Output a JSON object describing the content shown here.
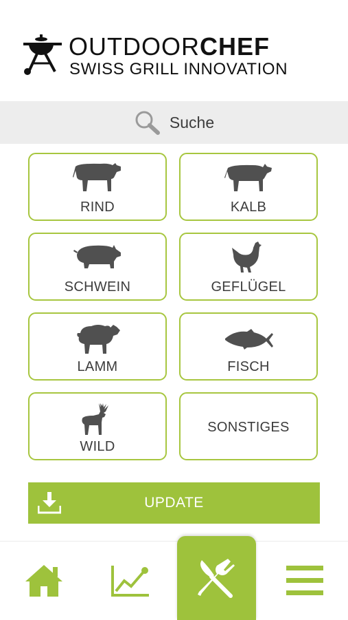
{
  "header": {
    "brand_light": "OUTDOOR",
    "brand_bold": "CHEF",
    "tagline": "SWISS GRILL INNOVATION",
    "logo_icon": "grill-icon"
  },
  "search": {
    "label": "Suche",
    "icon": "search-icon"
  },
  "categories": [
    {
      "label": "RIND",
      "icon": "cow-icon"
    },
    {
      "label": "KALB",
      "icon": "calf-icon"
    },
    {
      "label": "SCHWEIN",
      "icon": "pig-icon"
    },
    {
      "label": "GEFLÜGEL",
      "icon": "chicken-icon"
    },
    {
      "label": "LAMM",
      "icon": "sheep-icon"
    },
    {
      "label": "FISCH",
      "icon": "fish-icon"
    },
    {
      "label": "WILD",
      "icon": "deer-icon"
    },
    {
      "label": "SONSTIGES",
      "icon": ""
    }
  ],
  "update": {
    "label": "UPDATE",
    "icon": "download-icon"
  },
  "tabbar": {
    "items": [
      {
        "name": "home",
        "icon": "home-icon",
        "active": false
      },
      {
        "name": "stats",
        "icon": "chart-line-icon",
        "active": false
      },
      {
        "name": "recipes",
        "icon": "fork-knife-icon",
        "active": true
      },
      {
        "name": "menu",
        "icon": "hamburger-menu-icon",
        "active": false
      }
    ]
  },
  "colors": {
    "accent": "#9ec23c",
    "border": "#a7c63f",
    "text": "#3c3c3c",
    "searchbar": "#ededed",
    "icon": "#505050"
  }
}
